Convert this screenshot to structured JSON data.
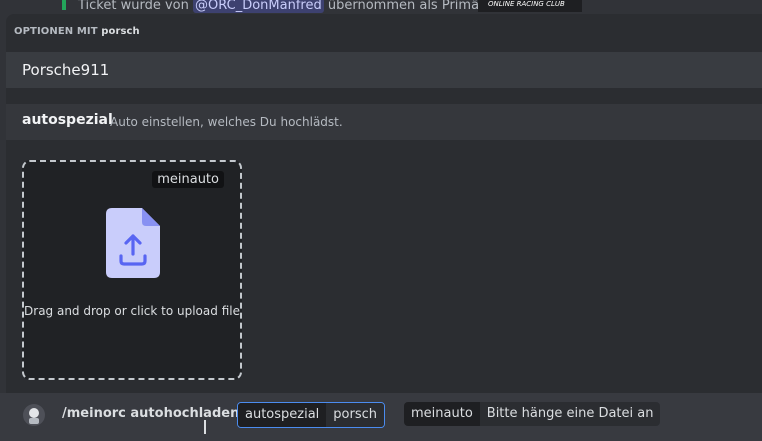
{
  "background_message": {
    "prefix": "Ticket wurde von",
    "mention": "@ORC_DonManfred",
    "suffix": "übernommen als Primärer",
    "logo_text": "ONLINE RACING CLUB"
  },
  "autocomplete": {
    "header_label": "OPTIONEN MIT",
    "header_query": "porsch",
    "options": [
      {
        "label": "Porsche911"
      }
    ]
  },
  "attachment_panel": {
    "option_name": "autospezial",
    "option_description": "Auto einstellen, welches Du hochlädst.",
    "dropzone": {
      "param_name": "meinauto",
      "text": "Drag and drop or click to upload file",
      "icon": "file-upload-icon"
    }
  },
  "command_bar": {
    "avatar_icon": "bot-avatar-icon",
    "command": "/meinorc autohochladen",
    "params": [
      {
        "name": "autospezial",
        "value": "porsch",
        "active": true
      },
      {
        "name": "meinauto",
        "value": "Bitte hänge eine Datei an",
        "active": false
      }
    ]
  },
  "colors": {
    "accent": "#5865f2",
    "focus_border": "#4b8cf0",
    "green_status": "#23a55a"
  }
}
